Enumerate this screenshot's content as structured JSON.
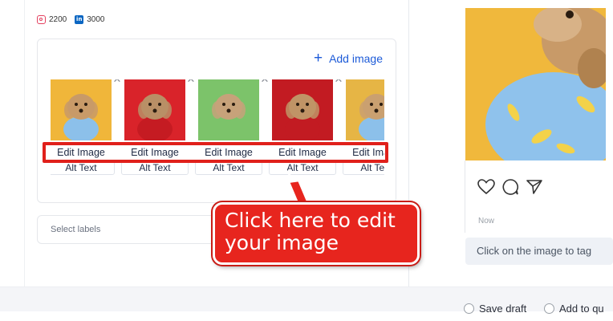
{
  "social": {
    "instagram_count": "2200",
    "linkedin_count": "3000"
  },
  "media": {
    "add_image_label": "Add image",
    "thumbnails": [
      {
        "bg": "#f0b63a",
        "shirt": "#8cc0ea",
        "fur": "#c89a68",
        "edit_label": "Edit Image",
        "alt_label": "Alt Text"
      },
      {
        "bg": "#d9232a",
        "shirt": "#c51b22",
        "fur": "#b98f66",
        "edit_label": "Edit Image",
        "alt_label": "Alt Text"
      },
      {
        "bg": "#7cc36a",
        "shirt": "#7cc36a",
        "fur": "#c7a27a",
        "edit_label": "Edit Image",
        "alt_label": "Alt Text"
      },
      {
        "bg": "#c21b22",
        "shirt": "#c21b22",
        "fur": "#c09466",
        "edit_label": "Edit Image",
        "alt_label": "Alt Text"
      },
      {
        "bg": "#e6b545",
        "shirt": "#8cc0ea",
        "fur": "#caa070",
        "edit_label": "Edit Image",
        "alt_label": "Alt Text"
      }
    ]
  },
  "labels": {
    "placeholder": "Select labels"
  },
  "callout": {
    "line1": "Click here to edit",
    "line2": "your image"
  },
  "preview": {
    "timestamp": "Now",
    "tag_hint": "Click on the image to tag"
  },
  "footer": {
    "save_draft": "Save draft",
    "add_to_queue": "Add to qu"
  },
  "colors": {
    "accent": "#1d5bd8",
    "annotation_red": "#e0201b"
  }
}
